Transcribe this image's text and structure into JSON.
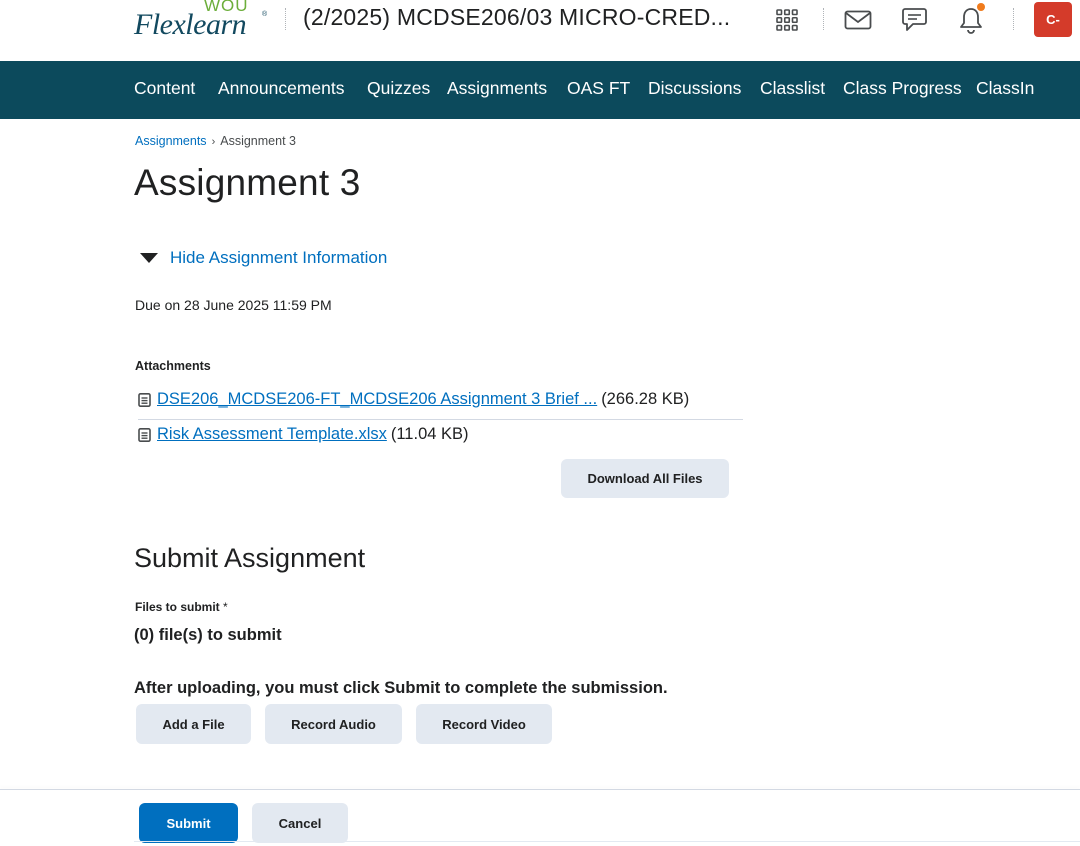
{
  "header": {
    "logo": {
      "top": "WOU",
      "main": "Flexlearn",
      "reg": "®"
    },
    "course_title": "(2/2025) MCDSE206/03 MICRO-CRED...",
    "icons": [
      "apps-grid-icon",
      "mail-icon",
      "chat-icon",
      "bell-icon"
    ],
    "avatar_initial": "C-",
    "avatar_color": "#d43b2a",
    "notification_dot_color": "#f07b1c"
  },
  "nav": {
    "items": [
      "Content",
      "Announcements",
      "Quizzes",
      "Assignments",
      "OAS FT",
      "Discussions",
      "Classlist",
      "Class Progress",
      "ClassIn"
    ],
    "background": "#0c4a5c"
  },
  "breadcrumb": {
    "parent": "Assignments",
    "separator": "›",
    "current": "Assignment 3"
  },
  "page_title": "Assignment 3",
  "info_toggle": "Hide Assignment Information",
  "due": "Due on 28 June 2025 11:59 PM",
  "attachments": {
    "heading": "Attachments",
    "files": [
      {
        "name": "DSE206_MCDSE206-FT_MCDSE206 Assignment 3 Brief ...",
        "size": "(266.28 KB)"
      },
      {
        "name": "Risk Assessment Template.xlsx",
        "size": "(11.04 KB)"
      }
    ],
    "download_all": "Download All Files"
  },
  "submit": {
    "heading": "Submit Assignment",
    "files_label": "Files to submit",
    "required_mark": "*",
    "files_count": "(0) file(s) to submit",
    "instruction": "After uploading, you must click Submit to complete the submission.",
    "buttons": {
      "add_file": "Add a File",
      "record_audio": "Record Audio",
      "record_video": "Record Video"
    }
  },
  "footer": {
    "submit": "Submit",
    "cancel": "Cancel"
  },
  "colors": {
    "link": "#006fbf",
    "primary": "#006fbf",
    "secondary_button": "#e3e9f1"
  }
}
